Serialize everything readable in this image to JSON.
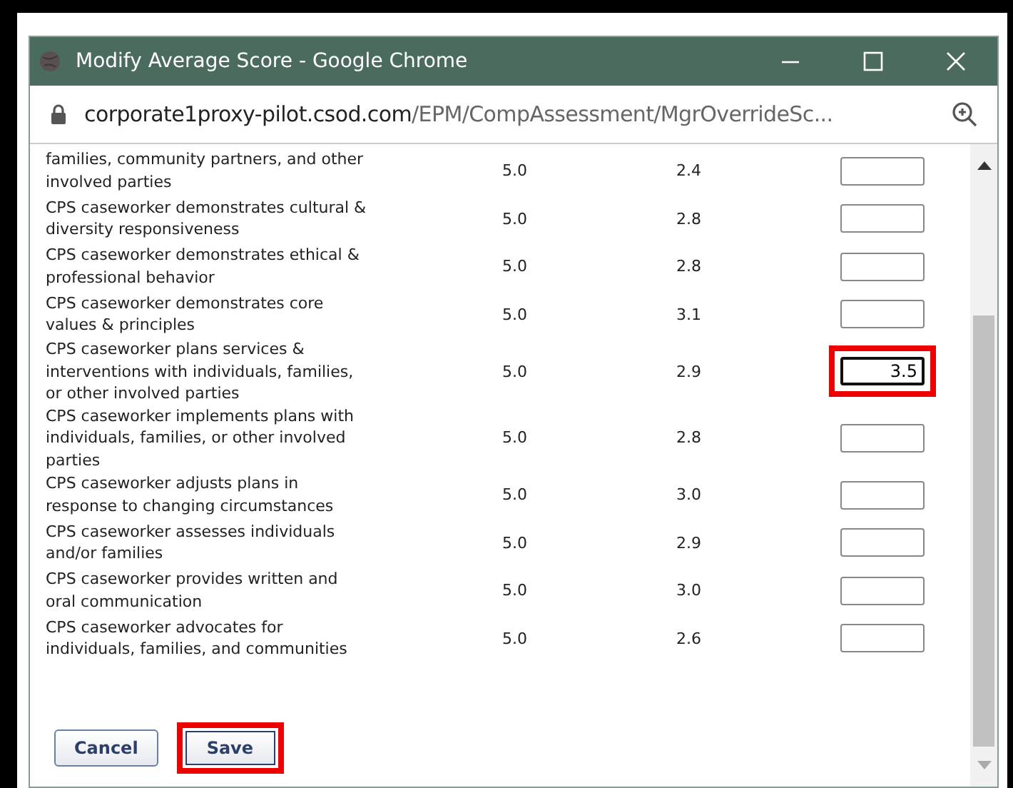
{
  "window": {
    "title": "Modify Average Score - Google Chrome"
  },
  "address_bar": {
    "domain": "corporate1proxy-pilot.csod.com",
    "path": "/EPM/CompAssessment/MgrOverrideSc..."
  },
  "rows": [
    {
      "competency": "families, community partners, and other\ninvolved parties",
      "max": "5.0",
      "average": "2.4",
      "override": "",
      "focused": false,
      "highlighted": false
    },
    {
      "competency": "CPS caseworker demonstrates cultural &\ndiversity responsiveness",
      "max": "5.0",
      "average": "2.8",
      "override": "",
      "focused": false,
      "highlighted": false
    },
    {
      "competency": "CPS caseworker demonstrates ethical &\nprofessional behavior",
      "max": "5.0",
      "average": "2.8",
      "override": "",
      "focused": false,
      "highlighted": false
    },
    {
      "competency": "CPS caseworker demonstrates core\nvalues & principles",
      "max": "5.0",
      "average": "3.1",
      "override": "",
      "focused": false,
      "highlighted": false
    },
    {
      "competency": "CPS caseworker plans services &\ninterventions with individuals, families,\nor other involved parties",
      "max": "5.0",
      "average": "2.9",
      "override": "3.5",
      "focused": true,
      "highlighted": true
    },
    {
      "competency": "CPS caseworker implements plans with\nindividuals, families, or other involved\nparties",
      "max": "5.0",
      "average": "2.8",
      "override": "",
      "focused": false,
      "highlighted": false
    },
    {
      "competency": "CPS caseworker adjusts plans in\nresponse to changing circumstances",
      "max": "5.0",
      "average": "3.0",
      "override": "",
      "focused": false,
      "highlighted": false
    },
    {
      "competency": "CPS caseworker assesses individuals\nand/or families",
      "max": "5.0",
      "average": "2.9",
      "override": "",
      "focused": false,
      "highlighted": false
    },
    {
      "competency": "CPS caseworker provides written and\noral communication",
      "max": "5.0",
      "average": "3.0",
      "override": "",
      "focused": false,
      "highlighted": false
    },
    {
      "competency": "CPS caseworker advocates for\nindividuals, families, and communities",
      "max": "5.0",
      "average": "2.6",
      "override": "",
      "focused": false,
      "highlighted": false
    }
  ],
  "buttons": [
    {
      "label": "Cancel",
      "kind": "secondary",
      "highlighted": false
    },
    {
      "label": "Save",
      "kind": "primary",
      "highlighted": true
    }
  ]
}
